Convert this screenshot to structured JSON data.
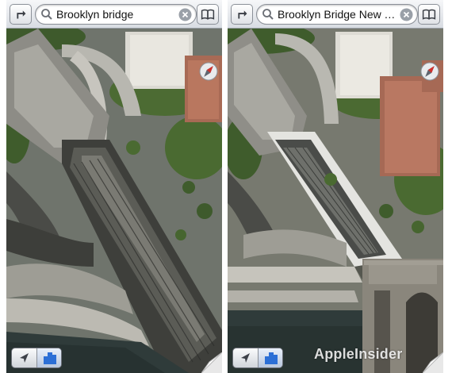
{
  "left_pane": {
    "search_query": "Brooklyn bridge",
    "icons": {
      "directions": "directions-arrow-icon",
      "search": "magnifier-icon",
      "clear": "clear-x-icon",
      "bookmarks": "bookmarks-book-icon",
      "compass": "compass-icon",
      "locate": "location-arrow-icon",
      "view_mode": "3d-buildings-icon",
      "page_curl": "page-curl-icon"
    }
  },
  "right_pane": {
    "search_query": "Brooklyn Bridge New Y...",
    "icons": {
      "directions": "directions-arrow-icon",
      "search": "magnifier-icon",
      "clear": "clear-x-icon",
      "bookmarks": "bookmarks-book-icon",
      "compass": "compass-icon",
      "locate": "location-arrow-icon",
      "view_mode": "3d-buildings-icon",
      "page_curl": "page-curl-icon"
    }
  },
  "watermark": "AppleInsider",
  "colors": {
    "toolbar_top": "#f6f7f9",
    "toolbar_bottom": "#d8dce2",
    "water": "#2f3b3a",
    "compass_red": "#d0312d",
    "3d_button_blue": "#2c6fd6"
  }
}
